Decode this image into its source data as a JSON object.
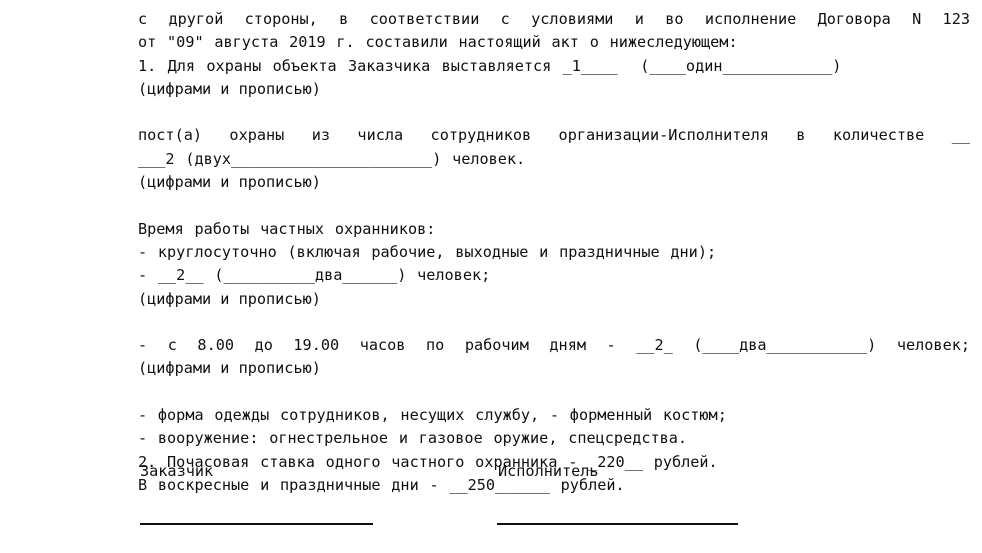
{
  "document": {
    "type": "act",
    "language": "ru",
    "contract_number": "123",
    "contract_date": "\"09\" августа 2019 г.",
    "posts_count_digits": "1",
    "posts_count_words": "один",
    "guards_count_digits": "2",
    "guards_count_words": "двух",
    "round_clock_count_digits": "2",
    "round_clock_count_words": "два",
    "day_shift_count_digits": "2",
    "day_shift_count_words": "два",
    "day_shift_from": "8.00",
    "day_shift_to": "19.00",
    "hourly_rate": "220",
    "holiday_rate": "250",
    "lines": [
      "с другой стороны, в соответствии с условиями и во исполнение Договора N 123",
      "от \"09\" августа 2019 г. составили настоящий акт о нижеследующем:",
      "1. Для охраны объекта Заказчика выставляется _1____  (____один____________)",
      "(цифрами и прописью)",
      "пост(а) охраны из числа сотрудников организации-Исполнителя в количестве __",
      "___2 (двух______________________) человек.",
      "(цифрами и прописью)",
      "Время работы частных охранников:",
      "- круглосуточно (включая рабочие, выходные и праздничные дни);",
      "- __2__ (__________два______) человек;",
      "(цифрами и прописью)",
      "- с 8.00 до 19.00 часов по рабочим дням - __2_ (____два___________) человек;",
      "(цифрами и прописью)",
      "- форма одежды сотрудников, несущих службу, - форменный костюм;",
      "- вооружение: огнестрельное и газовое оружие, спецсредства.",
      "2. Почасовая ставка одного частного охранника - _220__ рублей.",
      "В воскресные и праздничные дни - __250______ рублей."
    ],
    "signature": {
      "customer_label": "Заказчик",
      "contractor_label": "Исполнитель"
    }
  }
}
